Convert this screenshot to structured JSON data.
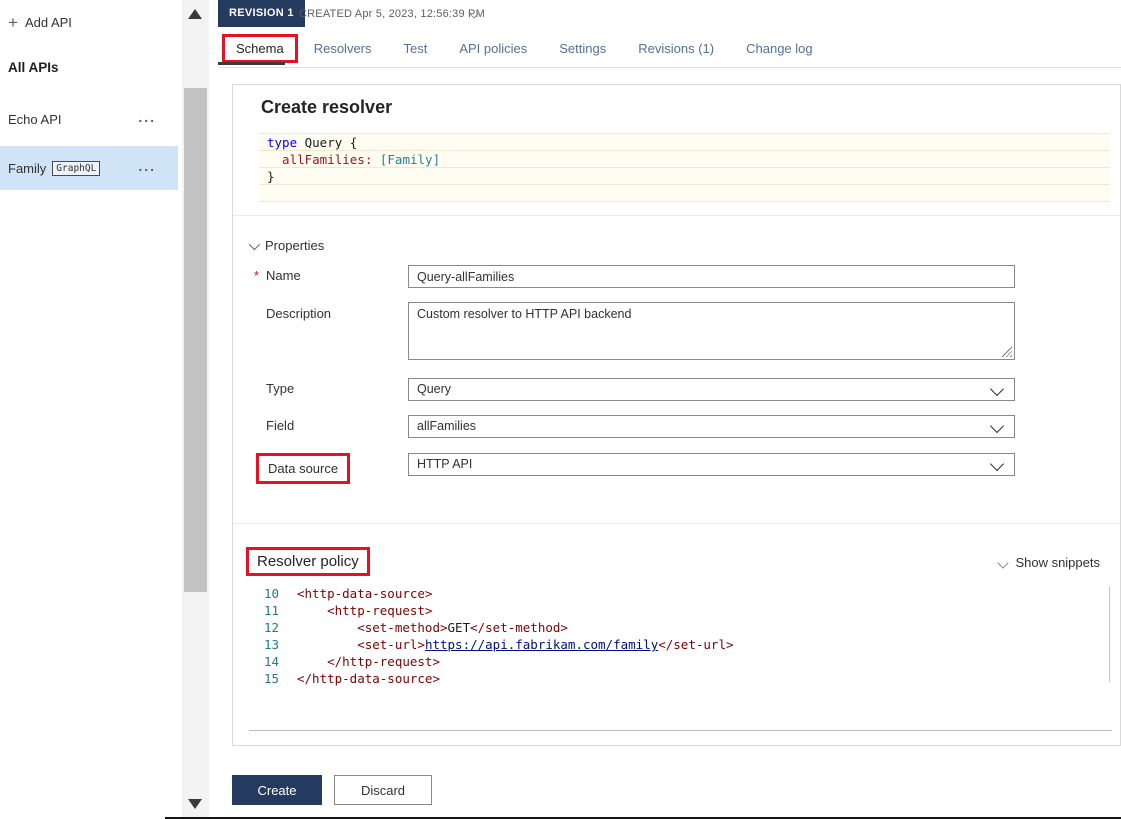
{
  "icons": {
    "plus": "+",
    "ellipsis": "..."
  },
  "colors": {
    "annotation_red": "#e81123",
    "primary_navy": "#243a5e",
    "tab_blue": "#537197",
    "selected_row_blue": "#cfe4f7"
  },
  "sidebar": {
    "add_api_label": "Add API",
    "all_apis_label": "All APIs",
    "items": [
      {
        "label": "Echo API",
        "badge": ""
      },
      {
        "label": "Family",
        "badge": "GraphQL"
      }
    ]
  },
  "header": {
    "revision_badge": "REVISION 1",
    "created_label": "CREATED Apr 5, 2023, 12:56:39 PM"
  },
  "tabs": [
    {
      "label": "Schema",
      "active": true
    },
    {
      "label": "Resolvers",
      "active": false
    },
    {
      "label": "Test",
      "active": false
    },
    {
      "label": "API policies",
      "active": false
    },
    {
      "label": "Settings",
      "active": false
    },
    {
      "label": "Revisions (1)",
      "active": false
    },
    {
      "label": "Change log",
      "active": false
    }
  ],
  "panel": {
    "title": "Create resolver",
    "properties_label": "Properties",
    "required_marker": "*",
    "fields": {
      "name": {
        "label": "Name",
        "value": "Query-allFamilies"
      },
      "description": {
        "label": "Description",
        "value": "Custom resolver to HTTP API backend"
      },
      "type": {
        "label": "Type",
        "value": "Query"
      },
      "field": {
        "label": "Field",
        "value": "allFamilies"
      },
      "data_source": {
        "label": "Data source",
        "value": "HTTP API"
      }
    },
    "resolver_policy": {
      "title": "Resolver policy",
      "show_snippets_label": "Show snippets"
    }
  },
  "schema_code": {
    "lines": [
      {
        "segments": [
          {
            "text": "type",
            "cls": "kw"
          },
          {
            "text": " Query {",
            "cls": "plain"
          }
        ]
      },
      {
        "segments": [
          {
            "text": "  allFamilies:",
            "cls": "field"
          },
          {
            "text": " [Family]",
            "cls": "type"
          }
        ]
      },
      {
        "segments": [
          {
            "text": "}",
            "cls": "plain"
          }
        ]
      },
      {
        "segments": []
      }
    ]
  },
  "policy_code": {
    "lines": [
      {
        "num": "10",
        "segments": [
          {
            "text": "<http-data-source>",
            "cls": "tag"
          }
        ]
      },
      {
        "num": "11",
        "segments": [
          {
            "text": "    <http-request>",
            "cls": "tag"
          }
        ]
      },
      {
        "num": "12",
        "segments": [
          {
            "text": "        <set-method>",
            "cls": "tag"
          },
          {
            "text": "GET",
            "cls": "plain"
          },
          {
            "text": "</set-method>",
            "cls": "tag"
          }
        ]
      },
      {
        "num": "13",
        "segments": [
          {
            "text": "        <set-url>",
            "cls": "tag"
          },
          {
            "text": "https://api.fabrikam.com/family",
            "cls": "url"
          },
          {
            "text": "</set-url>",
            "cls": "tag"
          }
        ]
      },
      {
        "num": "14",
        "segments": [
          {
            "text": "    </http-request>",
            "cls": "tag"
          }
        ]
      },
      {
        "num": "15",
        "segments": [
          {
            "text": "</http-data-source>",
            "cls": "tag"
          }
        ]
      }
    ]
  },
  "footer": {
    "create_label": "Create",
    "discard_label": "Discard"
  }
}
